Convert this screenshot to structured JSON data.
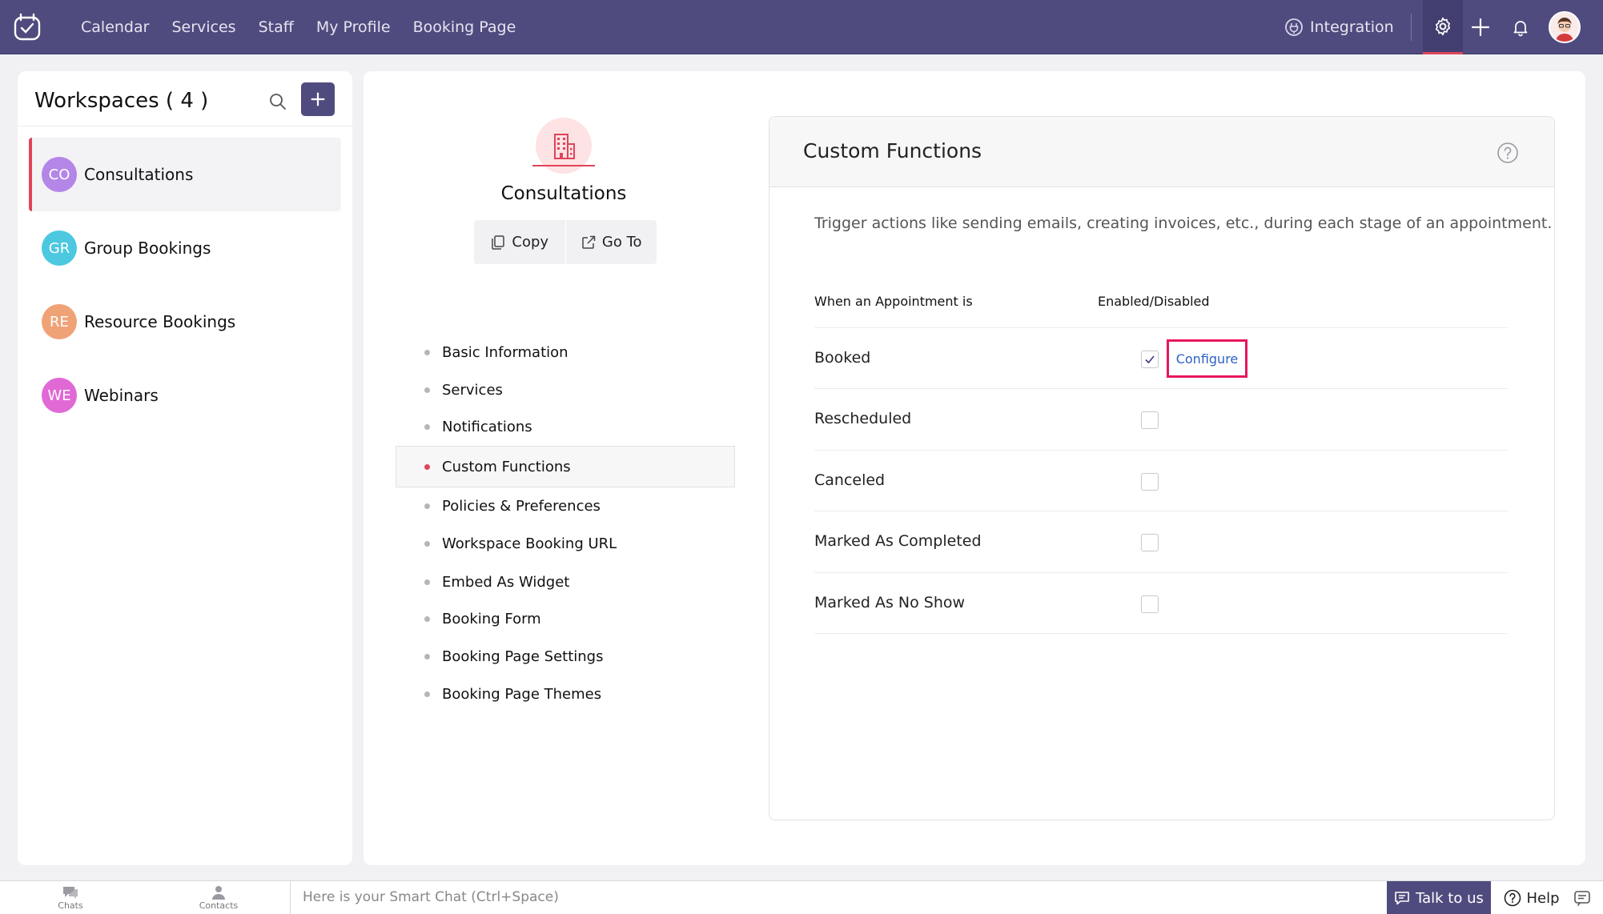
{
  "topnav": {
    "items": [
      "Calendar",
      "Services",
      "Staff",
      "My Profile",
      "Booking Page"
    ],
    "integration": "Integration"
  },
  "workspaces": {
    "title": "Workspaces ( 4 )",
    "items": [
      {
        "initials": "CO",
        "name": "Consultations",
        "color": "#b486e8"
      },
      {
        "initials": "GR",
        "name": "Group Bookings",
        "color": "#4cc8e0"
      },
      {
        "initials": "RE",
        "name": "Resource Bookings",
        "color": "#f0a277"
      },
      {
        "initials": "WE",
        "name": "Webinars",
        "color": "#e069d6"
      }
    ]
  },
  "workspace_detail": {
    "name": "Consultations",
    "copy_label": "Copy",
    "goto_label": "Go To",
    "menu": [
      "Basic Information",
      "Services",
      "Notifications",
      "Custom Functions",
      "Policies & Preferences",
      "Workspace Booking URL",
      "Embed As Widget",
      "Booking Form",
      "Booking Page Settings",
      "Booking Page Themes"
    ],
    "active_menu": "Custom Functions"
  },
  "custom_functions": {
    "title": "Custom Functions",
    "description": "Trigger actions like sending emails, creating invoices, etc., during each stage of an appointment.",
    "col_event": "When an Appointment is",
    "col_status": "Enabled/Disabled",
    "configure_label": "Configure",
    "rows": [
      {
        "label": "Booked",
        "enabled": true
      },
      {
        "label": "Rescheduled",
        "enabled": false
      },
      {
        "label": "Canceled",
        "enabled": false
      },
      {
        "label": "Marked As Completed",
        "enabled": false
      },
      {
        "label": "Marked As No Show",
        "enabled": false
      }
    ]
  },
  "bottombar": {
    "chats": "Chats",
    "contacts": "Contacts",
    "smartchat_placeholder": "Here is your Smart Chat (Ctrl+Space)",
    "talk": "Talk to us",
    "help": "Help"
  }
}
